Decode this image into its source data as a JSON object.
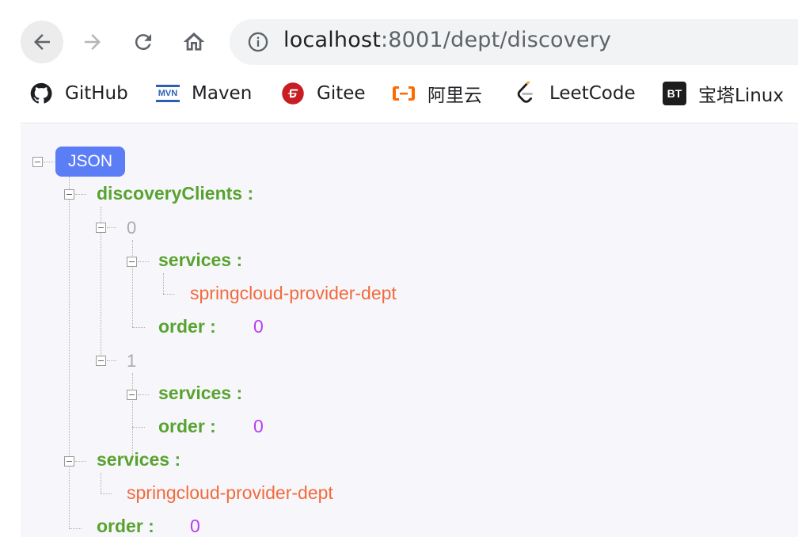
{
  "browser": {
    "url_host": "localhost",
    "url_rest": ":8001/dept/discovery",
    "bookmarks": [
      {
        "label": "GitHub",
        "icon": "github-icon"
      },
      {
        "label": "Maven",
        "icon": "maven-icon"
      },
      {
        "label": "Gitee",
        "icon": "gitee-icon"
      },
      {
        "label": "阿里云",
        "icon": "aliyun-icon"
      },
      {
        "label": "LeetCode",
        "icon": "leetcode-icon"
      },
      {
        "label": "宝塔Linux",
        "icon": "bt-icon"
      }
    ],
    "maven_icon_text": "MVN",
    "bt_icon_text": "BT"
  },
  "json_view": {
    "badge": "JSON",
    "discoveryClients_key": "discoveryClients :",
    "client0_index": "0",
    "client0_services_key": "services :",
    "client0_services_value": "springcloud-provider-dept",
    "client0_order_key": "order :",
    "client0_order_value": "0",
    "client1_index": "1",
    "client1_services_key": "services :",
    "client1_order_key": "order :",
    "client1_order_value": "0",
    "services_key": "services :",
    "services_value": "springcloud-provider-dept",
    "order_key": "order :",
    "order_value": "0"
  },
  "colors": {
    "key": "#58a32f",
    "string": "#f26a3c",
    "number": "#b83cf0",
    "badge": "#5b7ef7"
  }
}
